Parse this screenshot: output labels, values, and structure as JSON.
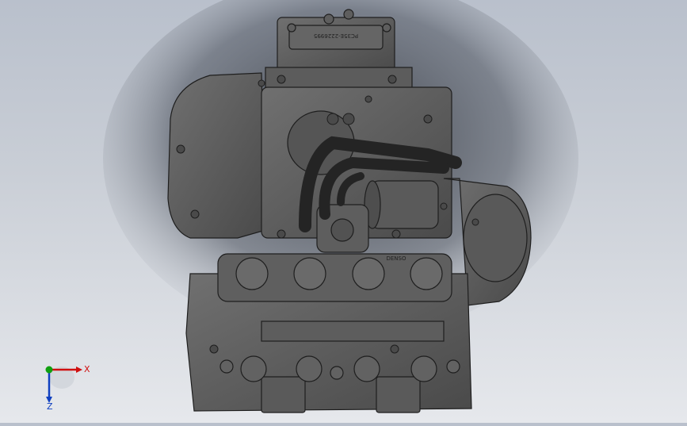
{
  "app": {
    "view": "3D model viewport"
  },
  "model": {
    "name_plate_text": "PC35E-2226995",
    "logo_text": "DENSO",
    "colors": {
      "body": "#585858",
      "edge": "#1e1e1e",
      "hose": "#2a2a2a",
      "highlight": "#808080"
    }
  },
  "triad": {
    "x_label": "X",
    "z_label": "Z",
    "colors": {
      "x": "#d01010",
      "y": "#10a010",
      "z": "#1040c0"
    }
  }
}
